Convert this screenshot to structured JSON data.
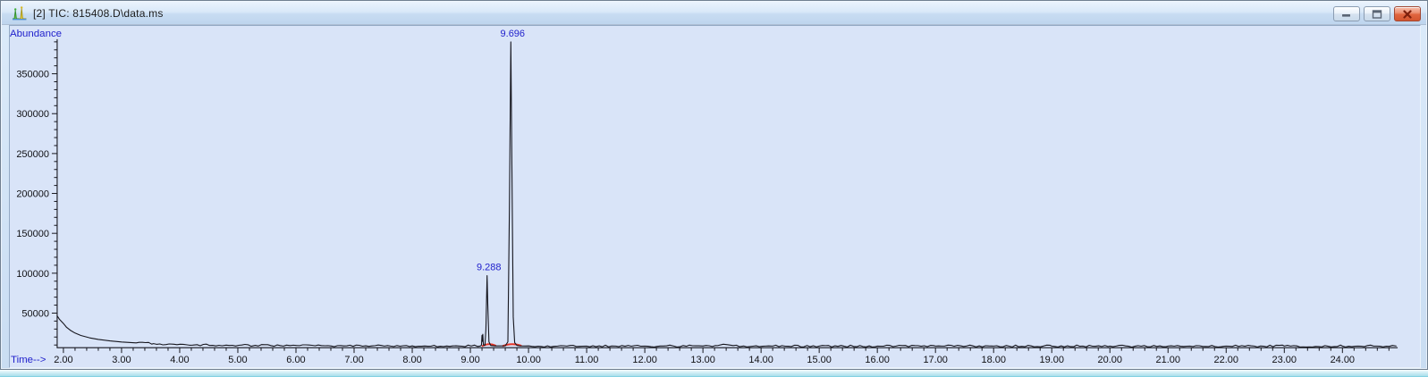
{
  "window": {
    "title": "[2] TIC: 815408.D\\data.ms",
    "controls": {
      "minimize": "minimize",
      "maximize": "maximize",
      "close": "close"
    }
  },
  "chart_data": {
    "type": "line",
    "title": "TIC: 815408.D\\data.ms",
    "xlabel": "Time-->",
    "ylabel": "Abundance",
    "xlim": [
      1.89,
      24.95
    ],
    "ylim": [
      6000,
      393000
    ],
    "x_ticks": {
      "major_start": 2,
      "major_end": 24,
      "major_step": 1,
      "minor_step": 0.2,
      "decimals": 2
    },
    "y_ticks": {
      "major_start": 50000,
      "major_end": 350000,
      "major_step": 50000,
      "minor_step": 10000,
      "minor_max": 390000
    },
    "peaks": [
      {
        "rt": 9.288,
        "abundance": 97000,
        "label": "9.288"
      },
      {
        "rt": 9.696,
        "abundance": 390000,
        "label": "9.696"
      }
    ],
    "integration_segments": [
      [
        9.21,
        9.43
      ],
      [
        9.56,
        9.87
      ]
    ],
    "trace": [
      [
        1.89,
        47000
      ],
      [
        1.93,
        42500
      ],
      [
        2.0,
        37000
      ],
      [
        2.05,
        32500
      ],
      [
        2.12,
        28500
      ],
      [
        2.2,
        25000
      ],
      [
        2.3,
        22000
      ],
      [
        2.45,
        19000
      ],
      [
        2.6,
        17000
      ],
      [
        2.8,
        15200
      ],
      [
        3.0,
        13800
      ],
      [
        3.25,
        12700
      ],
      [
        3.55,
        11800
      ],
      [
        3.9,
        11000
      ],
      [
        4.3,
        10400
      ],
      [
        4.8,
        9900
      ],
      [
        5.3,
        9600
      ],
      [
        5.9,
        9300
      ],
      [
        6.5,
        9100
      ],
      [
        7.2,
        8950
      ],
      [
        8.0,
        8850
      ],
      [
        8.8,
        8800
      ],
      [
        9.17,
        8800
      ],
      [
        9.19,
        9800
      ],
      [
        9.2,
        22000
      ],
      [
        9.206,
        14500
      ],
      [
        9.214,
        23500
      ],
      [
        9.225,
        10000
      ],
      [
        9.25,
        9600
      ],
      [
        9.268,
        30000
      ],
      [
        9.288,
        97000
      ],
      [
        9.3,
        60000
      ],
      [
        9.32,
        14000
      ],
      [
        9.35,
        9300
      ],
      [
        9.42,
        8900
      ],
      [
        9.5,
        8850
      ],
      [
        9.6,
        9000
      ],
      [
        9.645,
        14000
      ],
      [
        9.672,
        180000
      ],
      [
        9.696,
        390000
      ],
      [
        9.716,
        220000
      ],
      [
        9.738,
        45000
      ],
      [
        9.762,
        13000
      ],
      [
        9.8,
        9400
      ],
      [
        9.85,
        8900
      ],
      [
        9.95,
        8750
      ],
      [
        10.5,
        8700
      ],
      [
        11.0,
        8720
      ],
      [
        11.5,
        8700
      ],
      [
        12.0,
        8720
      ],
      [
        12.5,
        8700
      ],
      [
        13.0,
        8750
      ],
      [
        13.25,
        9200
      ],
      [
        13.35,
        11000
      ],
      [
        13.42,
        10400
      ],
      [
        13.52,
        9300
      ],
      [
        13.7,
        8800
      ],
      [
        14.2,
        8700
      ],
      [
        15.0,
        8680
      ],
      [
        16.0,
        8700
      ],
      [
        17.0,
        8680
      ],
      [
        18.0,
        8700
      ],
      [
        19.0,
        8680
      ],
      [
        20.0,
        8700
      ],
      [
        21.0,
        8680
      ],
      [
        22.0,
        8700
      ],
      [
        23.0,
        8680
      ],
      [
        24.0,
        8700
      ],
      [
        24.93,
        8680
      ]
    ],
    "colors": {
      "trace": "#16161e",
      "axis": "#16161e",
      "tick_label": "#101014",
      "axis_label": "#2121cc",
      "peak_label": "#2121cc",
      "integration": "#e93527",
      "plot_bg": "#d9e4f8"
    },
    "grid": false,
    "legend": null
  }
}
